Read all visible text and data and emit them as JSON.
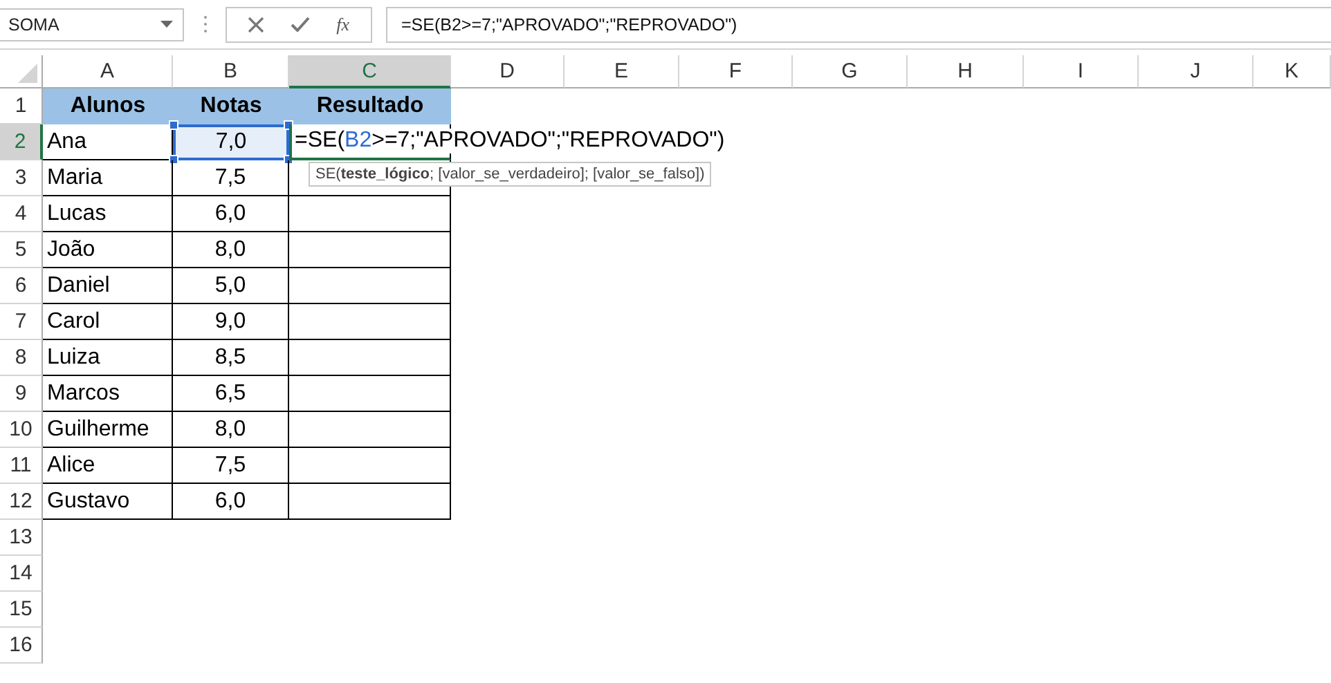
{
  "name_box": {
    "value": "SOMA"
  },
  "formula_bar": {
    "fx": "fx",
    "value": "=SE(B2>=7;\"APROVADO\";\"REPROVADO\")"
  },
  "columns": [
    {
      "label": "A",
      "selected": false
    },
    {
      "label": "B",
      "selected": false
    },
    {
      "label": "C",
      "selected": true
    },
    {
      "label": "D",
      "selected": false
    },
    {
      "label": "E",
      "selected": false
    },
    {
      "label": "F",
      "selected": false
    },
    {
      "label": "G",
      "selected": false
    },
    {
      "label": "H",
      "selected": false
    },
    {
      "label": "I",
      "selected": false
    },
    {
      "label": "J",
      "selected": false
    },
    {
      "label": "K",
      "selected": false
    }
  ],
  "rows": [
    {
      "label": "1",
      "selected": false,
      "cells": [
        {
          "kind": "header",
          "text": "Alunos",
          "selected": false
        },
        {
          "kind": "header",
          "text": "Notas",
          "selected": false
        },
        {
          "kind": "header",
          "text": "Resultado",
          "selected": false
        }
      ]
    },
    {
      "label": "2",
      "selected": true,
      "cells": [
        {
          "kind": "name",
          "text": "Ana",
          "selected": false
        },
        {
          "kind": "grade",
          "text": "7,0",
          "selected": true
        },
        {
          "kind": "editor",
          "selected": false,
          "parts": [
            {
              "kind": "plain",
              "text": "=SE("
            },
            {
              "kind": "reference",
              "text": "B2"
            },
            {
              "kind": "plain",
              "text": ">=7;\"APROVADO\";\"REPROVADO\")"
            }
          ],
          "tooltip": "SE(**teste_lógico**; [valor_se_verdadeiro]; [valor_se_falso])"
        }
      ]
    },
    {
      "label": "3",
      "selected": false,
      "cells": [
        {
          "kind": "name",
          "text": "Maria",
          "selected": false
        },
        {
          "kind": "grade",
          "text": "7,5",
          "selected": false
        },
        {
          "kind": "result",
          "selected": false
        }
      ]
    },
    {
      "label": "4",
      "selected": false,
      "cells": [
        {
          "kind": "name",
          "text": "Lucas",
          "selected": false
        },
        {
          "kind": "grade",
          "text": "6,0",
          "selected": false
        },
        {
          "kind": "result",
          "selected": false
        }
      ]
    },
    {
      "label": "5",
      "selected": false,
      "cells": [
        {
          "kind": "name",
          "text": "João",
          "selected": false
        },
        {
          "kind": "grade",
          "text": "8,0",
          "selected": false
        },
        {
          "kind": "result",
          "selected": false
        }
      ]
    },
    {
      "label": "6",
      "selected": false,
      "cells": [
        {
          "kind": "name",
          "text": "Daniel",
          "selected": false
        },
        {
          "kind": "grade",
          "text": "5,0",
          "selected": false
        },
        {
          "kind": "result",
          "selected": false
        }
      ]
    },
    {
      "label": "7",
      "selected": false,
      "cells": [
        {
          "kind": "name",
          "text": "Carol",
          "selected": false
        },
        {
          "kind": "grade",
          "text": "9,0",
          "selected": false
        },
        {
          "kind": "result",
          "selected": false
        }
      ]
    },
    {
      "label": "8",
      "selected": false,
      "cells": [
        {
          "kind": "name",
          "text": "Luiza",
          "selected": false
        },
        {
          "kind": "grade",
          "text": "8,5",
          "selected": false
        },
        {
          "kind": "result",
          "selected": false
        }
      ]
    },
    {
      "label": "9",
      "selected": false,
      "cells": [
        {
          "kind": "name",
          "text": "Marcos",
          "selected": false
        },
        {
          "kind": "grade",
          "text": "6,5",
          "selected": false
        },
        {
          "kind": "result",
          "selected": false
        }
      ]
    },
    {
      "label": "10",
      "selected": false,
      "cells": [
        {
          "kind": "name",
          "text": "Guilherme",
          "selected": false
        },
        {
          "kind": "grade",
          "text": "8,0",
          "selected": false
        },
        {
          "kind": "result",
          "selected": false
        }
      ]
    },
    {
      "label": "11",
      "selected": false,
      "cells": [
        {
          "kind": "name",
          "text": "Alice",
          "selected": false
        },
        {
          "kind": "grade",
          "text": "7,5",
          "selected": false
        },
        {
          "kind": "result",
          "selected": false
        }
      ]
    },
    {
      "label": "12",
      "selected": false,
      "cells": [
        {
          "kind": "name",
          "text": "Gustavo",
          "selected": false
        },
        {
          "kind": "grade",
          "text": "6,0",
          "selected": false
        },
        {
          "kind": "result",
          "selected": false
        }
      ]
    },
    {
      "label": "13",
      "selected": false
    },
    {
      "label": "14",
      "selected": false
    },
    {
      "label": "15",
      "selected": false
    },
    {
      "label": "16",
      "selected": false
    }
  ]
}
